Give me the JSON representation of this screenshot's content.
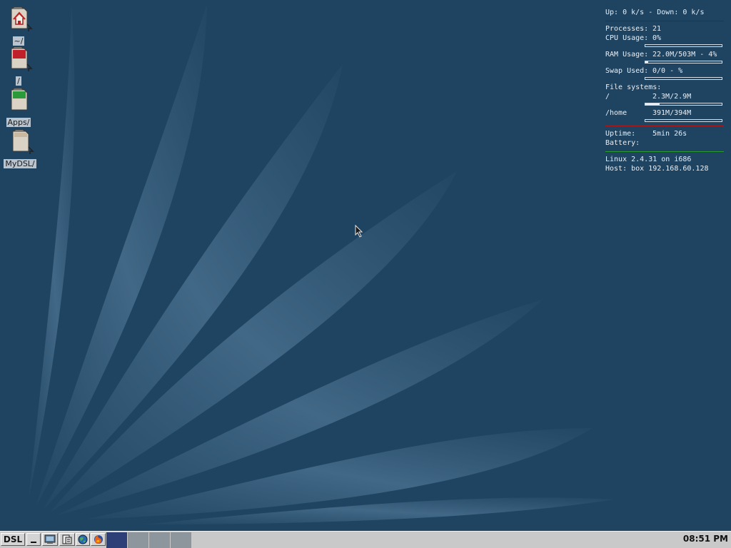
{
  "desktop": {
    "icons": [
      {
        "label": "~/",
        "icon": "home-folder-icon"
      },
      {
        "label": "/",
        "icon": "root-folder-icon"
      },
      {
        "label": "Apps/",
        "icon": "apps-folder-icon"
      },
      {
        "label": "MyDSL/",
        "icon": "mydsl-folder-icon"
      }
    ]
  },
  "conky": {
    "network": "Up: 0 k/s - Down: 0 k/s",
    "processes_label": "Processes:",
    "processes_value": "21",
    "cpu_label": "CPU Usage:",
    "cpu_value": "0%",
    "cpu_percent": 0,
    "ram_label": "RAM Usage:",
    "ram_value": "22.0M/503M - 4%",
    "ram_percent": 4,
    "swap_label": "Swap Used:",
    "swap_value": "0/0 - %",
    "swap_percent": 0,
    "fs_header": "File systems:",
    "fs": [
      {
        "mount": "/",
        "value": "2.3M/2.9M",
        "percent": 19
      },
      {
        "mount": "/home",
        "value": "391M/394M",
        "percent": 0
      }
    ],
    "uptime_label": "Uptime:",
    "uptime_value": "5min 26s",
    "battery_label": "Battery:",
    "battery_value": "",
    "kernel": "Linux 2.4.31 on i686",
    "host": "Host: box 192.168.60.128",
    "colors": {
      "network_line": "#1a2a9a",
      "uptime_line": "#b01818",
      "kernel_line": "#2a9a2a"
    }
  },
  "taskbar": {
    "start_label": "DSL",
    "buttons": [
      {
        "icon": "minimize-icon"
      },
      {
        "icon": "terminal-icon"
      },
      {
        "icon": "file-manager-icon"
      },
      {
        "icon": "web-browser-icon"
      },
      {
        "icon": "firefox-icon"
      }
    ],
    "workspaces": 4,
    "active_workspace": 1,
    "clock": "08:51 PM",
    "colors": {
      "active_workspace": "#2e3f78",
      "inactive_workspace": "#8d969d"
    }
  }
}
